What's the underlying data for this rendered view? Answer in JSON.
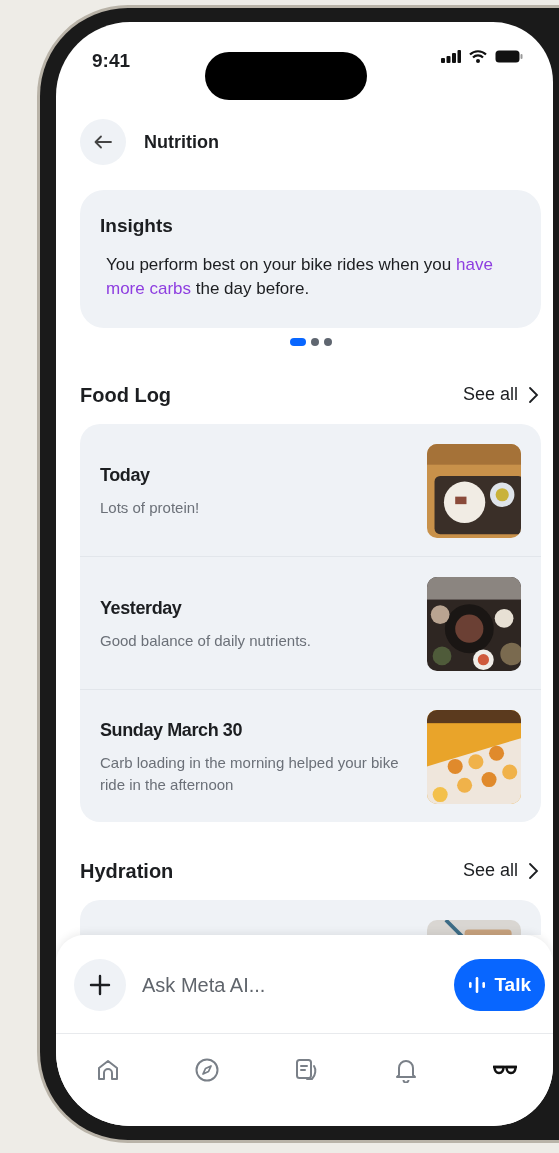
{
  "status_bar": {
    "time": "9:41"
  },
  "header": {
    "title": "Nutrition"
  },
  "insights": {
    "title": "Insights",
    "parts": [
      {
        "text": "You perform best on your bike rides when you ",
        "highlight": false
      },
      {
        "text": "have more carbs",
        "highlight": true
      },
      {
        "text": " the day before.",
        "highlight": false
      }
    ]
  },
  "pager": [
    {
      "selected": true
    },
    {
      "selected": false
    },
    {
      "selected": false
    }
  ],
  "food_log": {
    "title": "Food Log",
    "see_all": "See all",
    "entries": [
      {
        "title": "Today",
        "note": "Lots of protein!"
      },
      {
        "title": "Yesterday",
        "note": "Good balance of daily nutrients."
      },
      {
        "title": "Sunday March 30",
        "note": "Carb loading in the morning helped your bike ride in the afternoon"
      }
    ]
  },
  "hydration": {
    "title": "Hydration",
    "see_all": "See all"
  },
  "composer": {
    "placeholder": "Ask Meta AI...",
    "talk": "Talk"
  },
  "nav": [
    {
      "kind": "home",
      "selected": false
    },
    {
      "kind": "explore",
      "selected": false
    },
    {
      "kind": "feed",
      "selected": false
    },
    {
      "kind": "notifications",
      "selected": false
    },
    {
      "kind": "glasses",
      "selected": true
    }
  ]
}
